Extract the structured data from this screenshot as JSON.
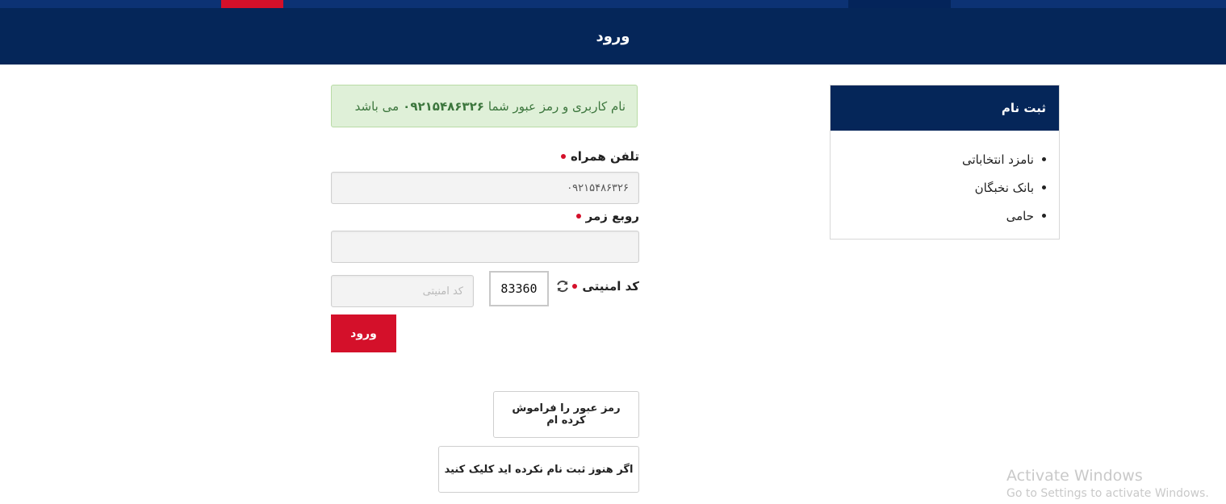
{
  "header": {
    "title": "ورود",
    "colors": {
      "bar": "#052659",
      "accent": "#d4102a"
    }
  },
  "alert": {
    "prefix": "نام کاربری و رمز عبور شما",
    "number": "۰۹۲۱۵۴۸۶۳۲۶",
    "suffix": "می باشد"
  },
  "form": {
    "phone_label": "تلفن همراه",
    "phone_value": "۰۹۲۱۵۴۸۶۳۲۶",
    "password_label": "روبع زمر",
    "password_value": "",
    "captcha_label": "کد امنیتی",
    "captcha_code": "83360",
    "captcha_placeholder": "کد امنیتی",
    "refresh_icon": "refresh-icon",
    "submit_label": "ورود",
    "forgot_label": "رمز عبور را فراموش کرده ام",
    "register_label": "اگر هنوز ثبت نام نکرده اید کلیک کنید"
  },
  "sidebar": {
    "title": "ثبت نام",
    "items": [
      {
        "label": "نامزد انتخاباتی"
      },
      {
        "label": "بانک نخبگان"
      },
      {
        "label": "حامی"
      }
    ]
  },
  "watermark": {
    "title": "Activate Windows",
    "subtitle": "Go to Settings to activate Windows."
  }
}
